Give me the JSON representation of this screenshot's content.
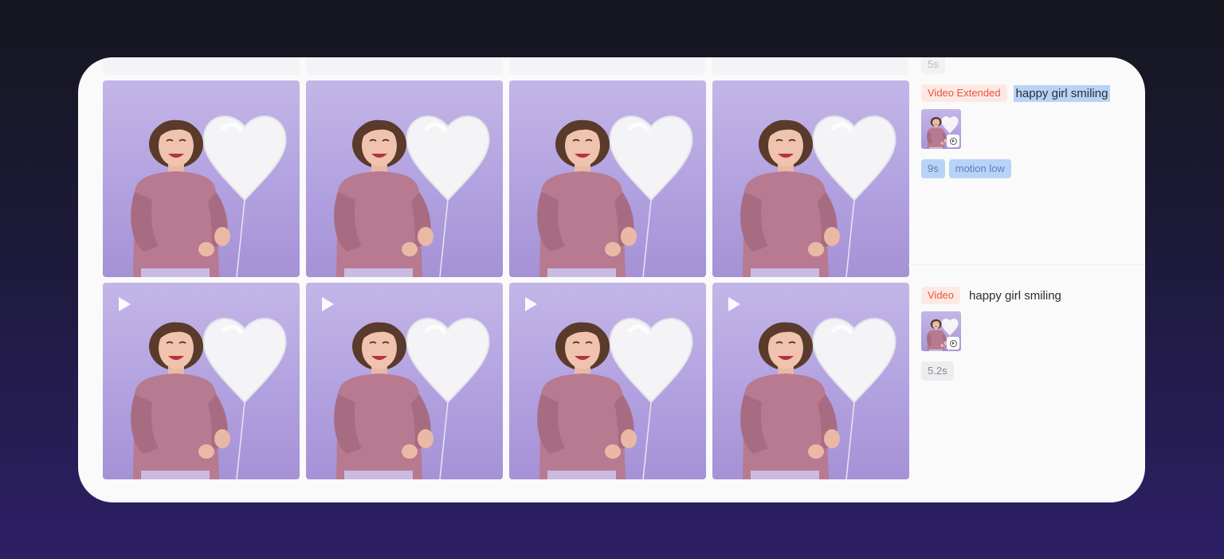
{
  "previous_entry": {
    "duration": "5s"
  },
  "entries": [
    {
      "type_label": "Video Extended",
      "prompt": "happy girl smiling",
      "chips": [
        "9s",
        "motion low"
      ],
      "tiles": [
        {
          "name": "result-tile-1",
          "has_play": false
        },
        {
          "name": "result-tile-2",
          "has_play": false
        },
        {
          "name": "result-tile-3",
          "has_play": false
        },
        {
          "name": "result-tile-4",
          "has_play": false
        }
      ]
    },
    {
      "type_label": "Video",
      "prompt": "happy girl smiling",
      "chips": [
        "5.2s"
      ],
      "tiles": [
        {
          "name": "video-tile-1",
          "has_play": true
        },
        {
          "name": "video-tile-2",
          "has_play": true
        },
        {
          "name": "video-tile-3",
          "has_play": true
        },
        {
          "name": "video-tile-4",
          "has_play": true
        }
      ]
    }
  ],
  "icons": {
    "play": "play-icon",
    "thumb_play": "play-circle-icon"
  },
  "colors": {
    "badge_red": "#e8553d",
    "chip_blue": "#b9d3f6",
    "selection": "#b9d3f6"
  }
}
